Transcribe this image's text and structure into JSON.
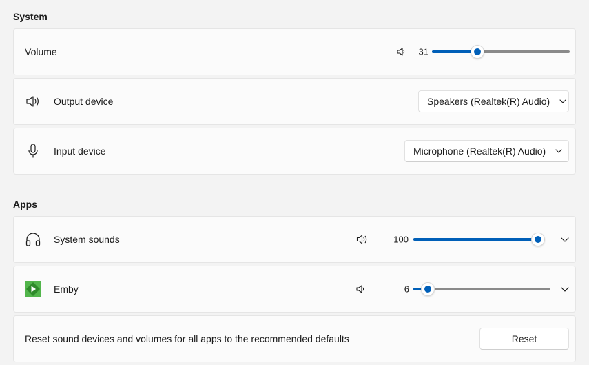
{
  "system_section": {
    "title": "System",
    "volume": {
      "label": "Volume",
      "value": "31",
      "level": 0.31,
      "icon": "speaker-icon"
    },
    "output_device": {
      "label": "Output device",
      "selected": "Speakers (Realtek(R) Audio)",
      "icon": "speaker-loud-icon"
    },
    "input_device": {
      "label": "Input device",
      "selected": "Microphone (Realtek(R) Audio)",
      "icon": "microphone-icon"
    }
  },
  "apps_section": {
    "title": "Apps",
    "apps": [
      {
        "label": "System sounds",
        "value": "100",
        "level": 1.0,
        "icon": "headphones-icon"
      },
      {
        "label": "Emby",
        "value": "6",
        "level": 0.06,
        "icon": "emby-app-icon"
      }
    ]
  },
  "reset": {
    "text": "Reset sound devices and volumes for all apps to the recommended defaults",
    "button_label": "Reset"
  },
  "colors": {
    "accent": "#005fb8",
    "track": "#8a8a8a",
    "emby_green": "#52b54b"
  }
}
